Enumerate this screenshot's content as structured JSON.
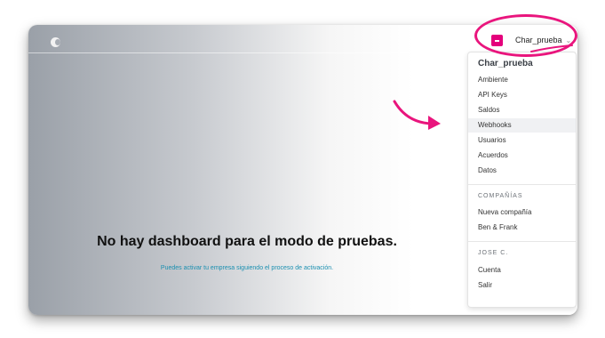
{
  "account": {
    "name": "Char_prueba"
  },
  "dropdown": {
    "title": "Char_prueba",
    "items": [
      {
        "label": "Ambiente"
      },
      {
        "label": "API Keys"
      },
      {
        "label": "Saldos"
      },
      {
        "label": "Webhooks"
      },
      {
        "label": "Usuarios"
      },
      {
        "label": "Acuerdos"
      },
      {
        "label": "Datos"
      }
    ],
    "companies_header": "COMPAÑÍAS",
    "companies": [
      {
        "label": "Nueva compañía"
      },
      {
        "label": "Ben & Frank"
      }
    ],
    "user_header": "JOSE C.",
    "user_items": [
      {
        "label": "Cuenta"
      },
      {
        "label": "Salir"
      }
    ]
  },
  "main": {
    "title": "No hay dashboard para el modo de pruebas.",
    "subtitle": "Puedes activar tu empresa siguiendo el proceso de activación."
  },
  "colors": {
    "accent": "#e4007c",
    "annotation": "#e9157d",
    "link": "#1a8fb0"
  },
  "icons": {
    "logo": "app-logo-icon",
    "avatar": "avatar-icon",
    "chevron": "chevron-down-icon"
  }
}
